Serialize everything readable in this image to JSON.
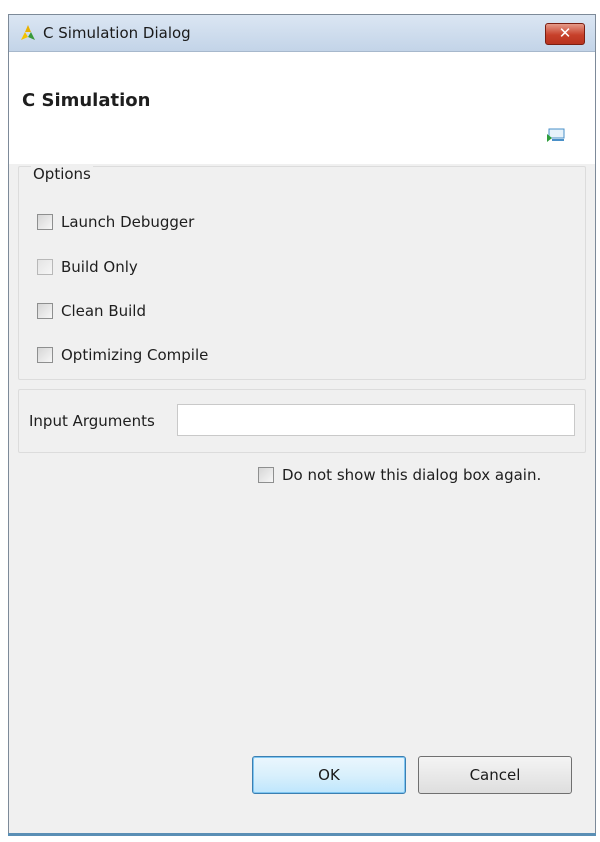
{
  "window": {
    "title": "C Simulation Dialog",
    "close_label": "✕"
  },
  "header": {
    "title": "C Simulation"
  },
  "options": {
    "group_label": "Options",
    "items": [
      {
        "label": "Launch Debugger",
        "checked": false,
        "enabled": true
      },
      {
        "label": "Build Only",
        "checked": false,
        "enabled": false
      },
      {
        "label": "Clean Build",
        "checked": false,
        "enabled": true
      },
      {
        "label": "Optimizing Compile",
        "checked": false,
        "enabled": true
      }
    ]
  },
  "arguments": {
    "label": "Input Arguments",
    "value": ""
  },
  "dont_show": {
    "label": "Do not show this dialog box again.",
    "checked": false
  },
  "buttons": {
    "ok_label": "OK",
    "cancel_label": "Cancel"
  },
  "colors": {
    "window_bg": "#f0f0f0",
    "header_bg": "#ffffff",
    "close_button": "#c7402a",
    "default_button_border": "#3c7fb1"
  },
  "icons": {
    "app": "xilinx-logo-icon",
    "header": "dialog-banner-icon"
  }
}
